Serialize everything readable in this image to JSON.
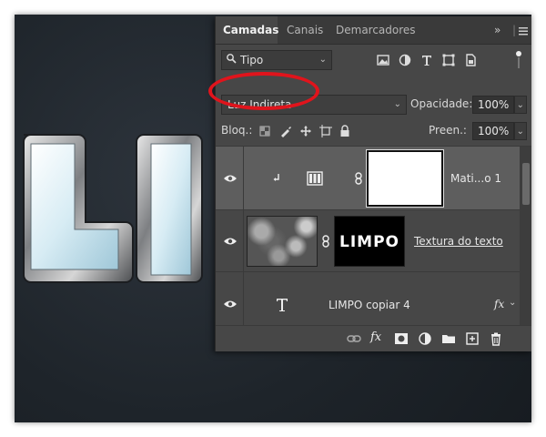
{
  "panel": {
    "tabs": [
      {
        "label": "Camadas",
        "active": true
      },
      {
        "label": "Canais",
        "active": false
      },
      {
        "label": "Demarcadores",
        "active": false
      }
    ],
    "collapse_icon": "double-chevron-right-icon",
    "menu_icon": "hamburger-menu-icon"
  },
  "filter": {
    "kind_value": "Tipo",
    "icons": [
      "image-filter-icon",
      "adjustment-filter-icon",
      "type-filter-icon",
      "shape-filter-icon",
      "smart-object-filter-icon"
    ]
  },
  "blend": {
    "mode_value": "Luz Indireta",
    "opacity_label": "Opacidade:",
    "opacity_value": "100%"
  },
  "lock": {
    "label": "Bloq.:",
    "fill_label": "Preen.:",
    "fill_value": "100%"
  },
  "layers": [
    {
      "name": "Mati...o 1",
      "type": "adjustment",
      "selected": true,
      "visible": true
    },
    {
      "name": "Textura do texto",
      "type": "clipped-image",
      "mask_text": "LIMPO",
      "visible": true
    },
    {
      "name": "LIMPO copiar 4",
      "type": "text",
      "fx": "fx",
      "visible": true
    }
  ],
  "bottom_icons": [
    "link-layers-icon",
    "fx-icon",
    "add-mask-icon",
    "adjustment-icon",
    "new-group-icon",
    "new-layer-icon",
    "delete-icon"
  ],
  "colors": {
    "highlight": "#e0141c",
    "panel_bg": "#474747",
    "selected_row": "#5c5c5c"
  }
}
